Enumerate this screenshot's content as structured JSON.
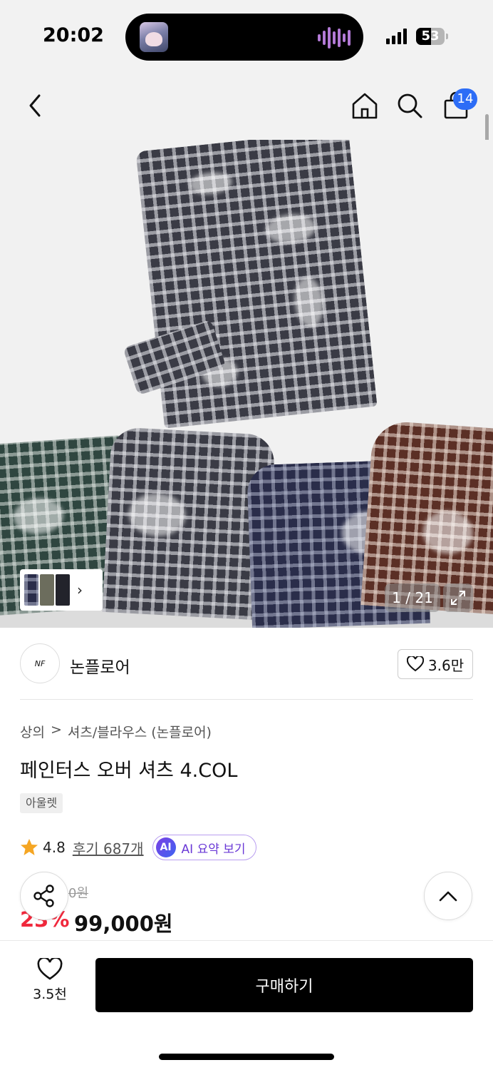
{
  "status": {
    "time": "20:02",
    "battery": "53",
    "battery_level": 0.53
  },
  "nav": {
    "back_icon": "chevron-left-icon",
    "home_icon": "home-icon",
    "search_icon": "search-icon",
    "cart_icon": "shopping-bag-icon",
    "cart_count": "14"
  },
  "gallery": {
    "counter": "1 / 21",
    "thumb_more_icon": "chevron-right-icon",
    "expand_icon": "expand-icon"
  },
  "seller": {
    "logo_text": "NF",
    "name": "논플로어",
    "follow_count": "3.6만"
  },
  "breadcrumb": {
    "level1": "상의",
    "separator": ">",
    "level2": "셔츠/블라우스 (논플로어)"
  },
  "product": {
    "title": "페인터스 오버 셔츠 4.COL",
    "tag": "아울렛",
    "rating": "4.8",
    "review_link": "후기 687개",
    "ai_badge": "AI",
    "ai_summary": "AI 요약 보기",
    "original_price": "0원",
    "discount": "23%",
    "price": "99,000원"
  },
  "bottom": {
    "like_count": "3.5천",
    "buy_label": "구매하기"
  },
  "colors": {
    "accent_blue": "#2d6df6",
    "discount_red": "#f0283c",
    "ai_purple": "#6a39d6",
    "star": "#f5a623"
  }
}
